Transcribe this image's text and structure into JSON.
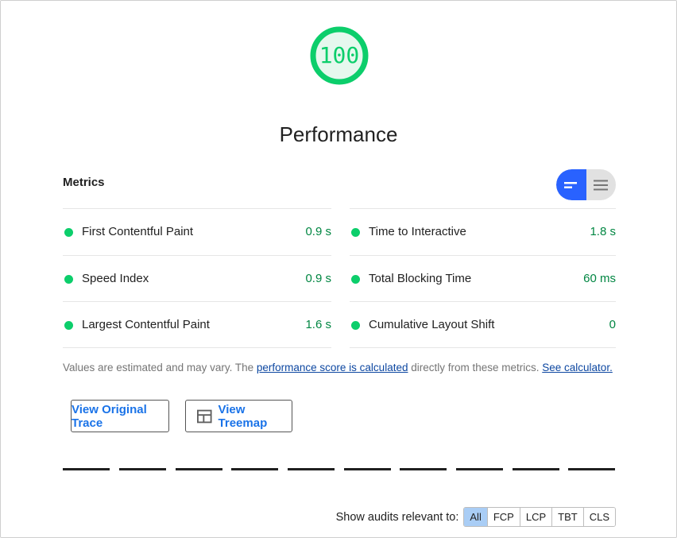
{
  "score": {
    "value": "100",
    "color": "#0cce6b"
  },
  "category": {
    "title": "Performance"
  },
  "metrics": {
    "title": "Metrics",
    "toggle": {
      "compact_icon": "lines-compact-icon",
      "expanded_icon": "lines-expanded-icon"
    },
    "left": [
      {
        "label": "First Contentful Paint",
        "value": "0.9 s"
      },
      {
        "label": "Speed Index",
        "value": "0.9 s"
      },
      {
        "label": "Largest Contentful Paint",
        "value": "1.6 s"
      }
    ],
    "right": [
      {
        "label": "Time to Interactive",
        "value": "1.8 s"
      },
      {
        "label": "Total Blocking Time",
        "value": "60 ms"
      },
      {
        "label": "Cumulative Layout Shift",
        "value": "0"
      }
    ]
  },
  "note": {
    "prefix": "Values are estimated and may vary. The ",
    "link1": "performance score is calculated",
    "middle": " directly from these metrics. ",
    "link2": "See calculator."
  },
  "buttons": {
    "trace": "View Original Trace",
    "treemap": "View Treemap",
    "treemap_icon": "treemap-icon"
  },
  "filter": {
    "label": "Show audits relevant to:",
    "options": [
      "All",
      "FCP",
      "LCP",
      "TBT",
      "CLS"
    ],
    "active": "All"
  }
}
